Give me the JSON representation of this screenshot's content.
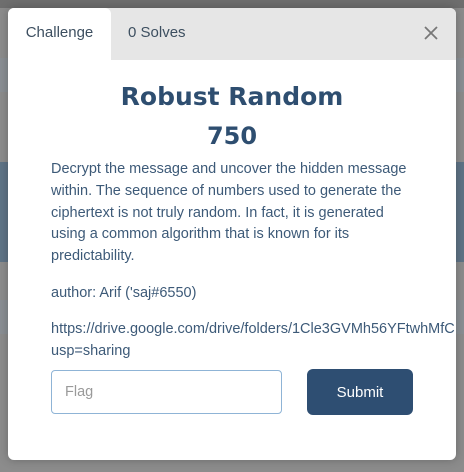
{
  "tabs": [
    {
      "label": "Challenge"
    },
    {
      "label": "0 Solves"
    }
  ],
  "challenge": {
    "title": "Robust Random",
    "points": "750",
    "description": "Decrypt the message and uncover the hidden message within. The sequence of numbers used to generate the ciphertext is not truly random. In fact, it is generated using a common algorithm that is known for its predictability.",
    "author": "author: Arif ('saj#6550)",
    "link_line1": "https://drive.google.com/drive/folders/1Cle3GVMh56YFtwhMfC",
    "link_line2": "usp=sharing"
  },
  "form": {
    "flag_placeholder": "Flag",
    "flag_value": "",
    "submit_label": "Submit"
  },
  "icons": {
    "close": "close-icon"
  },
  "colors": {
    "accent": "#2e4e72",
    "text": "#3d5a78",
    "input_border": "#8fb4d6"
  }
}
